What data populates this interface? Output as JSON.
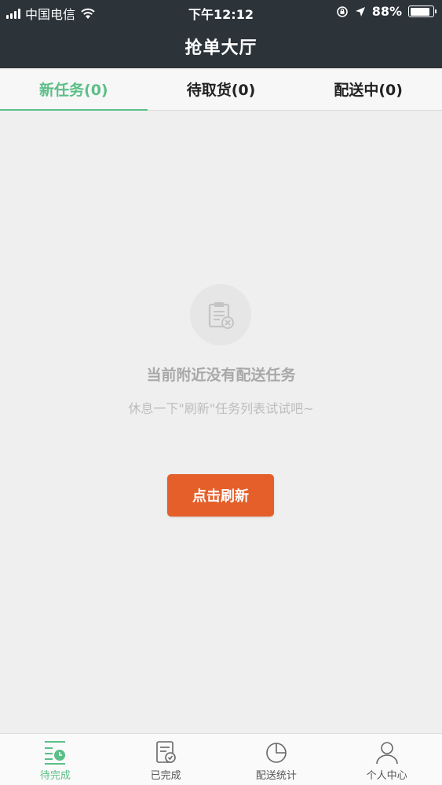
{
  "status_bar": {
    "carrier": "中国电信",
    "time": "下午12:12",
    "battery": "88%",
    "battery_level": 0.88,
    "icons": [
      "signal-icon",
      "wifi-icon",
      "rotation-lock-icon",
      "location-arrow-icon",
      "battery-icon"
    ]
  },
  "header": {
    "title": "抢单大厅"
  },
  "tabs": [
    {
      "label": "新任务(0)",
      "active": true
    },
    {
      "label": "待取货(0)",
      "active": false
    },
    {
      "label": "配送中(0)",
      "active": false
    }
  ],
  "empty_state": {
    "icon": "clipboard-x-icon",
    "title": "当前附近没有配送任务",
    "subtitle": "休息一下\"刷新\"任务列表试试吧~",
    "button_label": "点击刷新"
  },
  "bottom_nav": [
    {
      "label": "待完成",
      "icon": "pending-list-icon",
      "active": true
    },
    {
      "label": "已完成",
      "icon": "completed-doc-icon",
      "active": false
    },
    {
      "label": "配送统计",
      "icon": "pie-chart-icon",
      "active": false
    },
    {
      "label": "个人中心",
      "icon": "person-icon",
      "active": false
    }
  ],
  "colors": {
    "header_bg": "#2c3339",
    "accent_green": "#5bbf87",
    "button_orange": "#e55f2a",
    "page_bg": "#efefef"
  }
}
